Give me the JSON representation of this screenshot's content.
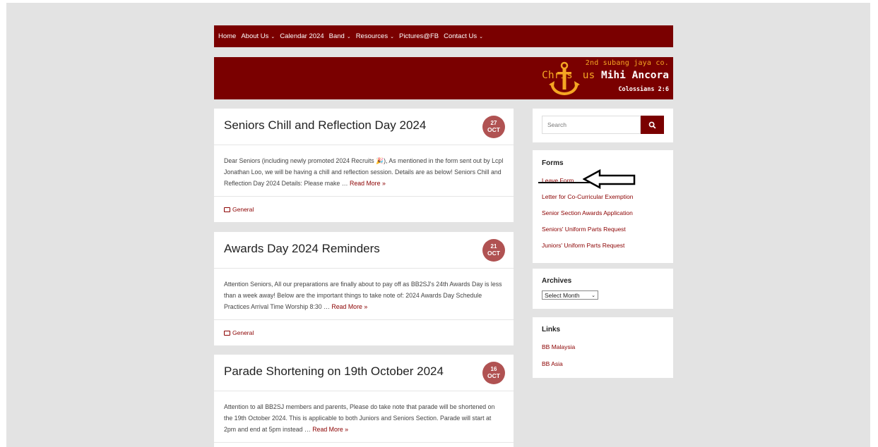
{
  "nav": {
    "items": [
      {
        "label": "Home",
        "dropdown": false
      },
      {
        "label": "About Us",
        "dropdown": true
      },
      {
        "label": "Calendar 2024",
        "dropdown": false
      },
      {
        "label": "Band",
        "dropdown": true
      },
      {
        "label": "Resources",
        "dropdown": true
      },
      {
        "label": "Pictures@FB",
        "dropdown": false
      },
      {
        "label": "Contact Us",
        "dropdown": true
      }
    ]
  },
  "banner": {
    "subtitle": "2nd subang jaya co.",
    "motto_left": "Chris",
    "motto_mid": "us",
    "motto_right": "Mihi Ancora",
    "verse": "Colossians 2:6"
  },
  "posts": [
    {
      "title": "Seniors Chill and Reflection Day 2024",
      "day": "27",
      "month": "OCT",
      "excerpt": "Dear Seniors (including newly promoted 2024 Recruits 🎉), As mentioned in the form sent out by Lcpl Jonathan Loo, we will be having a chill and reflection session. Details are as below! Seniors Chill and Reflection Day 2024 Details: Please make … ",
      "read_more": "Read More »",
      "category": "General"
    },
    {
      "title": "Awards Day 2024 Reminders",
      "day": "21",
      "month": "OCT",
      "excerpt": "Attention Seniors, All our preparations are finally about to pay off as BB2SJ's 24th Awards Day is less than a week away! Below are the important things to take note of: 2024 Awards Day Schedule Practices Arrival Time Worship 8:30 … ",
      "read_more": "Read More »",
      "category": "General"
    },
    {
      "title": "Parade Shortening on 19th October 2024",
      "day": "16",
      "month": "OCT",
      "excerpt": "Attention to all BB2SJ members and parents, Please do take note that parade will be shortened on the 19th October 2024. This is applicable to both Juniors and Seniors Section. Parade will start at 2pm and end at 5pm instead … ",
      "read_more": "Read More »",
      "category": ""
    }
  ],
  "search": {
    "placeholder": "Search"
  },
  "forms": {
    "title": "Forms",
    "links": [
      "Leave Form",
      "Letter for Co-Curricular Exemption",
      "Senior Section Awards Application",
      "Seniors' Uniform Parts Request",
      "Juniors' Uniform Parts Request"
    ]
  },
  "archives": {
    "title": "Archives",
    "selected": "Select Month"
  },
  "links": {
    "title": "Links",
    "items": [
      "BB Malaysia",
      "BB Asia"
    ]
  },
  "colors": {
    "brand": "#7a0000",
    "date_badge": "#b05252",
    "link": "#8b0000",
    "logo_gold": "#f5a623"
  }
}
